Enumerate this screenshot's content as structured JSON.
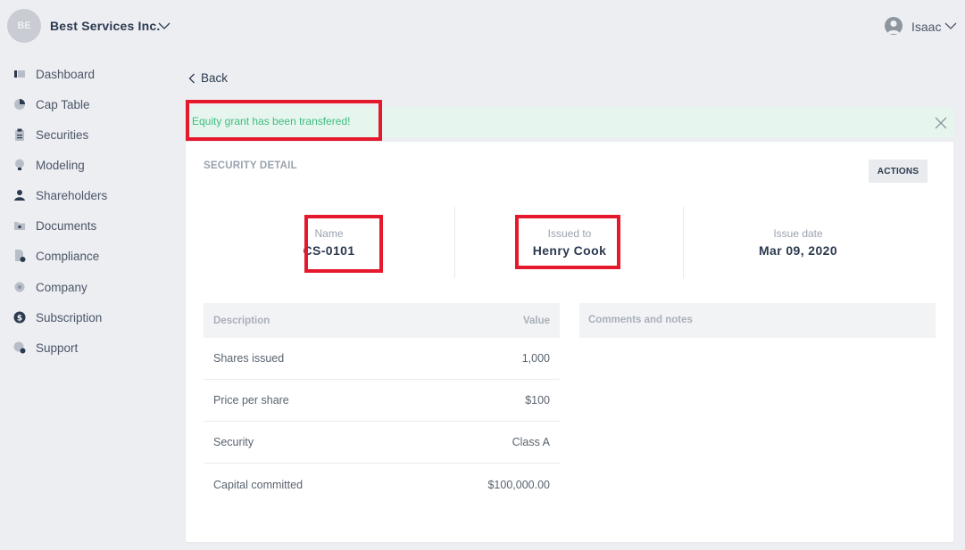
{
  "company": {
    "initials": "BE",
    "name": "Best Services Inc."
  },
  "user": {
    "name": "Isaac"
  },
  "sidebar": {
    "items": [
      {
        "label": "Dashboard",
        "icon": "dashboard-icon"
      },
      {
        "label": "Cap Table",
        "icon": "pie-chart-icon"
      },
      {
        "label": "Securities",
        "icon": "clipboard-icon"
      },
      {
        "label": "Modeling",
        "icon": "bulb-icon"
      },
      {
        "label": "Shareholders",
        "icon": "person-icon"
      },
      {
        "label": "Documents",
        "icon": "folder-icon"
      },
      {
        "label": "Compliance",
        "icon": "document-check-icon"
      },
      {
        "label": "Company",
        "icon": "building-icon"
      },
      {
        "label": "Subscription",
        "icon": "dollar-icon"
      },
      {
        "label": "Support",
        "icon": "support-icon"
      }
    ]
  },
  "back": {
    "label": "Back"
  },
  "alert": {
    "message": "Equity grant has been transfered!"
  },
  "detail": {
    "title": "SECURITY DETAIL",
    "actions_label": "ACTIONS",
    "summary": [
      {
        "label": "Name",
        "value": "CS-0101"
      },
      {
        "label": "Issued to",
        "value": "Henry Cook"
      },
      {
        "label": "Issue date",
        "value": "Mar 09, 2020"
      }
    ],
    "table": {
      "headers": {
        "description": "Description",
        "value": "Value"
      },
      "rows": [
        {
          "description": "Shares issued",
          "value": "1,000"
        },
        {
          "description": "Price per share",
          "value": "$100"
        },
        {
          "description": "Security",
          "value": "Class A"
        },
        {
          "description": "Capital committed",
          "value": "$100,000.00"
        }
      ]
    },
    "comments_header": "Comments and notes"
  },
  "colors": {
    "background": "#edeef2",
    "alert_bg": "#e6f6ef",
    "alert_text": "#3fbb7e",
    "highlight": "#e5192b",
    "text_primary": "#2b3a4f"
  }
}
